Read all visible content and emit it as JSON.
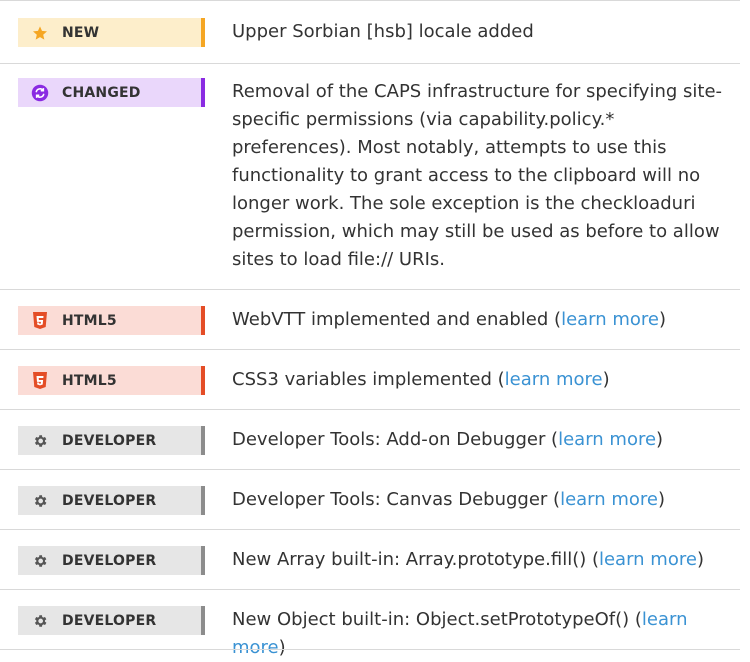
{
  "colors": {
    "new_bg": "#fdeecb",
    "new_accent": "#f5a623",
    "changed_bg": "#ead7fb",
    "changed_accent": "#8a2be2",
    "html5_bg": "#fbdcd6",
    "html5_accent": "#e44d26",
    "developer_bg": "#e6e6e6",
    "developer_accent": "#8c8c8c",
    "link": "#3a92d3",
    "text": "#333333"
  },
  "notes": [
    {
      "tag": "NEW",
      "icon": "star-icon",
      "text": "Upper Sorbian [hsb] locale added"
    },
    {
      "tag": "CHANGED",
      "icon": "refresh-icon",
      "text": "Removal of the CAPS infrastructure for specifying site-specific permissions (via capability.policy.* preferences). Most notably, attempts to use this functionality to grant access to the clipboard will no longer work. The sole exception is the checkloaduri permission, which may still be used as before to allow sites to load file:// URIs."
    },
    {
      "tag": "HTML5",
      "icon": "html5-icon",
      "text": "WebVTT implemented and enabled (",
      "link": "learn more",
      "suffix": ")"
    },
    {
      "tag": "HTML5",
      "icon": "html5-icon",
      "text": "CSS3 variables implemented (",
      "link": "learn more",
      "suffix": ")"
    },
    {
      "tag": "DEVELOPER",
      "icon": "gear-icon",
      "text": "Developer Tools: Add-on Debugger (",
      "link": "learn more",
      "suffix": ")"
    },
    {
      "tag": "DEVELOPER",
      "icon": "gear-icon",
      "text": "Developer Tools: Canvas Debugger (",
      "link": "learn more",
      "suffix": ")"
    },
    {
      "tag": "DEVELOPER",
      "icon": "gear-icon",
      "text": "New Array built-in: Array.prototype.fill() (",
      "link": "learn more",
      "suffix": ")"
    },
    {
      "tag": "DEVELOPER",
      "icon": "gear-icon",
      "text": "New Object built-in: Object.setPrototypeOf() (",
      "link": "learn more",
      "suffix": ")"
    }
  ]
}
